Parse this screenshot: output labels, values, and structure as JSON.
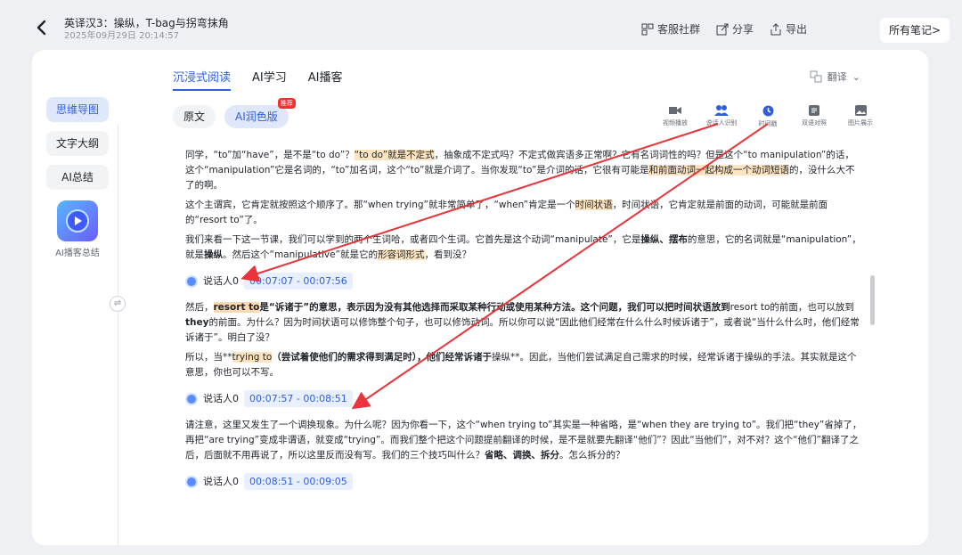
{
  "header": {
    "title": "英译汉3：操纵，T-bag与拐弯抹角",
    "date": "2025年09月29日 20:14:57",
    "actions": [
      {
        "label": "客服社群",
        "icon": "grid-icon"
      },
      {
        "label": "分享",
        "icon": "share-icon"
      },
      {
        "label": "导出",
        "icon": "export-icon"
      }
    ],
    "all_notes": "所有笔记>"
  },
  "left_nav": {
    "items": [
      "思维导图",
      "文字大纲",
      "AI总结"
    ],
    "active_item": "思维导图",
    "ai_podcast_label": "AI播客总结"
  },
  "tabs": {
    "items": [
      "沉浸式阅读",
      "AI学习",
      "AI播客"
    ],
    "active": "沉浸式阅读",
    "translate": "翻译"
  },
  "modes": {
    "original": "原文",
    "polished": "AI润色版",
    "badge": "推荐"
  },
  "tools": [
    {
      "label": "视频播放",
      "icon": "video-icon"
    },
    {
      "label": "说话人识别",
      "icon": "speakers-icon"
    },
    {
      "label": "时间戳",
      "icon": "clock-icon"
    },
    {
      "label": "双语对照",
      "icon": "bilingual-icon"
    },
    {
      "label": "图片展示",
      "icon": "image-icon"
    }
  ],
  "content": {
    "p1": {
      "a": "同学，“to”加“have”，是不是“to do”？",
      "hl1": "“to do”就是不定式",
      "b": "，抽象成不定式吗？不定式做宾语多正常啊？它有名词词性的吗？但是这个“to manipulation”的话，这个“manipulation”它是名词的，“to”加名词，这个“to”就是介词了。当你发现“to”是介词的话，它很有可能是",
      "hl2": "和前面动词一起构成一个动词短语",
      "c": "的，没什么大不了的啊。"
    },
    "p2": {
      "a": "这个主谓宾，它肯定就按照这个顺序了。那“when trying”就非常简单了，“when”肯定是一个",
      "hl": "时间状语",
      "b": "，时间状语，它肯定就是前面的动词，可能就是前面的“resort to”了。"
    },
    "p3": {
      "a": "我们来看一下这一节课，我们可以学到的两个生词哈，或者四个生词。它首先是这个动词“manipulate”，它是",
      "bold": "操纵、摆布",
      "b": "的意思，它的名词就是“manipulation”，就是",
      "bold2": "操纵",
      "c": "。然后这个“manipulative”就是它的",
      "hl": "形容词形式",
      "d": "，看到没？"
    },
    "speaker1": {
      "name": "说话人0",
      "time": "00:07:07 - 00:07:56"
    },
    "p4": {
      "a": "然后，",
      "hl": "resort to",
      "bold": "是“诉诸于”的意思，表示因为没有其他选择而采取某种行动或使用某种方法。这个问题，我们可以把时间状语放到",
      "b": "resort to的前面，也可以放到",
      "bold2": "they",
      "c": "的前面。为什么？因为时间状语可以修饰整个句子，也可以修饰动词。所以你可以说“因此他们经常在什么什么时候诉诸于”，或者说“当什么什么时，他们经常诉诸于”。明白了没？"
    },
    "p5": {
      "a": "所以，当**",
      "hl": "trying to",
      "bold": "（尝试着使他们的需求得到满足时），他们经常诉诸于",
      "b": "操纵**。因此，当他们尝试满足自己需求的时候，经常诉诸于操纵的手法。其实就是这个意思，你也可以不写。"
    },
    "speaker2": {
      "name": "说话人0",
      "time": "00:07:57 - 00:08:51"
    },
    "p6": {
      "a": "请注意，这里又发生了一个调换现象。为什么呢？因为你看一下，这个“when trying to”其实是一种省略，是“when they are trying to”。我们把“they”省掉了，再把“are trying”变成非谓语，就变成“trying”。而我们整个把这个问题提前翻译的时候，是不是就要先翻译“他们”？因此“当他们”，对不对？这个“他们”翻译了之后，后面就不用再说了，所以这里反而没有写。我们的三个技巧叫什么？",
      "bold": "省略、调换、拆分",
      "b": "。怎么拆分的？"
    },
    "speaker3": {
      "name": "说话人0",
      "time": "00:08:51 - 00:09:05"
    }
  },
  "colors": {
    "accent": "#2f5ee0",
    "highlight": "#fde4bf",
    "arrow": "#e8343a"
  }
}
